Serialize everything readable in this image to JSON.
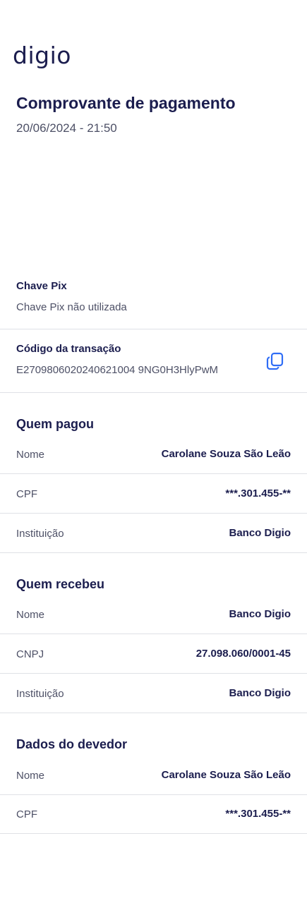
{
  "header": {
    "logo": "digio",
    "title": "Comprovante de pagamento",
    "datetime": "20/06/2024 - 21:50"
  },
  "pix_key": {
    "label": "Chave Pix",
    "value": "Chave Pix não utilizada"
  },
  "transaction": {
    "label": "Código da transação",
    "code": "E2709806020240621004 9NG0H3HlyPwM",
    "copy_icon": "copy-icon"
  },
  "payer": {
    "title": "Quem pagou",
    "rows": [
      {
        "label": "Nome",
        "value": "Carolane Souza São Leão"
      },
      {
        "label": "CPF",
        "value": "***.301.455-**"
      },
      {
        "label": "Instituição",
        "value": "Banco Digio"
      }
    ]
  },
  "receiver": {
    "title": "Quem recebeu",
    "rows": [
      {
        "label": "Nome",
        "value": "Banco Digio"
      },
      {
        "label": "CNPJ",
        "value": "27.098.060/0001-45"
      },
      {
        "label": "Instituição",
        "value": "Banco Digio"
      }
    ]
  },
  "debtor": {
    "title": "Dados do devedor",
    "rows": [
      {
        "label": "Nome",
        "value": "Carolane Souza São Leão"
      },
      {
        "label": "CPF",
        "value": "***.301.455-**"
      }
    ]
  },
  "colors": {
    "primary_text": "#1b1d4e",
    "secondary_text": "#4d5066",
    "accent": "#2f6df6",
    "divider": "#dfe1e6"
  }
}
